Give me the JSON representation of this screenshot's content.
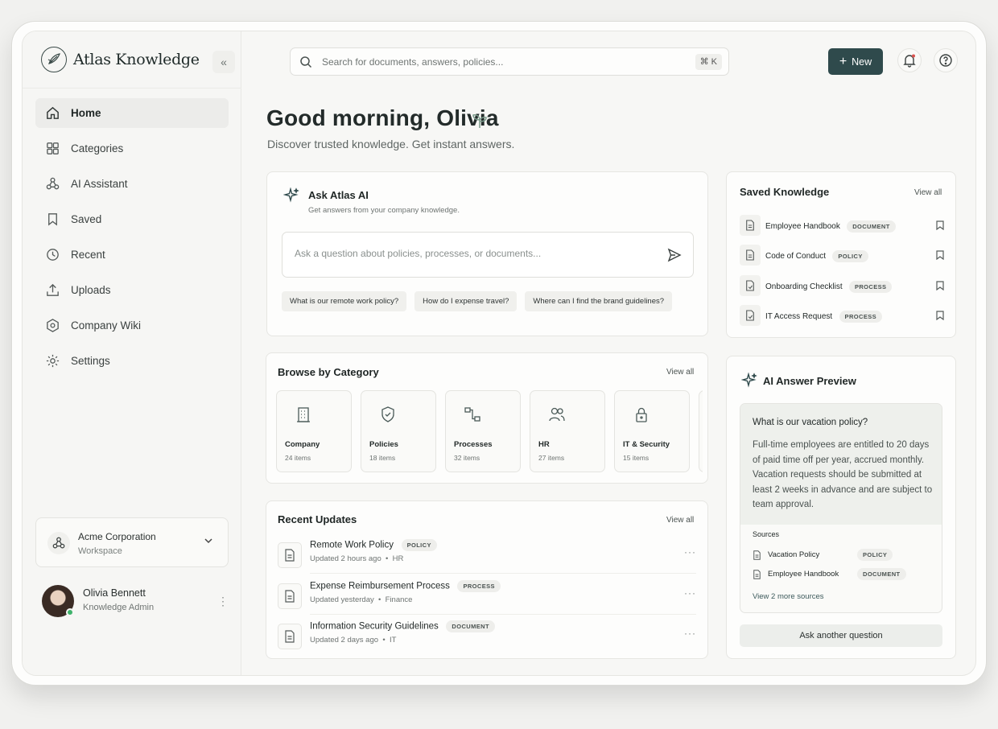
{
  "app": {
    "name": "Atlas Knowledge",
    "collapse_label": "«"
  },
  "sidebar": {
    "items": [
      {
        "label": "Home",
        "icon": "home-icon",
        "active": true
      },
      {
        "label": "Categories",
        "icon": "grid-icon"
      },
      {
        "label": "AI Assistant",
        "icon": "ai-assistant-icon"
      },
      {
        "label": "Saved",
        "icon": "bookmark-icon"
      },
      {
        "label": "Recent",
        "icon": "clock-icon"
      },
      {
        "label": "Uploads",
        "icon": "upload-icon"
      },
      {
        "label": "Company Wiki",
        "icon": "wiki-icon"
      },
      {
        "label": "Settings",
        "icon": "gear-icon"
      }
    ],
    "workspace": {
      "name": "Acme Corporation",
      "type": "Workspace"
    },
    "user": {
      "name": "Olivia Bennett",
      "role": "Knowledge Admin"
    }
  },
  "topbar": {
    "search_placeholder": "Search for documents, answers, policies...",
    "shortcut": "⌘ K",
    "new_label": "New"
  },
  "greeting": {
    "title": "Good morning, Olivia",
    "subtitle": "Discover trusted knowledge. Get instant answers."
  },
  "ask": {
    "title": "Ask Atlas AI",
    "subtitle": "Get answers from your company knowledge.",
    "placeholder": "Ask a question about policies, processes, or documents...",
    "suggestions": [
      "What is our remote work policy?",
      "How do I expense travel?",
      "Where can I find the brand guidelines?"
    ]
  },
  "browse": {
    "title": "Browse by Category",
    "view_all": "View all",
    "categories": [
      {
        "name": "Company",
        "count": "24 items"
      },
      {
        "name": "Policies",
        "count": "18 items"
      },
      {
        "name": "Processes",
        "count": "32 items"
      },
      {
        "name": "HR",
        "count": "27 items"
      },
      {
        "name": "IT & Security",
        "count": "15 items"
      }
    ]
  },
  "updates": {
    "title": "Recent Updates",
    "view_all": "View all",
    "items": [
      {
        "title": "Remote Work Policy",
        "tag": "POLICY",
        "time": "Updated 2 hours ago",
        "dept": "HR"
      },
      {
        "title": "Expense Reimbursement Process",
        "tag": "PROCESS",
        "time": "Updated yesterday",
        "dept": "Finance"
      },
      {
        "title": "Information Security Guidelines",
        "tag": "DOCUMENT",
        "time": "Updated 2 days ago",
        "dept": "IT"
      }
    ]
  },
  "saved": {
    "title": "Saved Knowledge",
    "view_all": "View all",
    "items": [
      {
        "name": "Employee Handbook",
        "tag": "DOCUMENT"
      },
      {
        "name": "Code of Conduct",
        "tag": "POLICY"
      },
      {
        "name": "Onboarding Checklist",
        "tag": "PROCESS"
      },
      {
        "name": "IT Access Request",
        "tag": "PROCESS"
      }
    ]
  },
  "preview": {
    "title": "AI Answer Preview",
    "question": "What is our vacation policy?",
    "answer": "Full-time employees are entitled to 20 days of paid time off per year, accrued monthly. Vacation requests should be submitted at least 2 weeks in advance and are subject to team approval.",
    "sources_label": "Sources",
    "sources": [
      {
        "name": "Vacation Policy",
        "tag": "POLICY"
      },
      {
        "name": "Employee Handbook",
        "tag": "DOCUMENT"
      }
    ],
    "more_sources": "View 2 more sources",
    "button": "Ask another question"
  },
  "colors": {
    "accent": "#2f4a4c",
    "online": "#3fb26b",
    "notification": "#d9534f"
  }
}
